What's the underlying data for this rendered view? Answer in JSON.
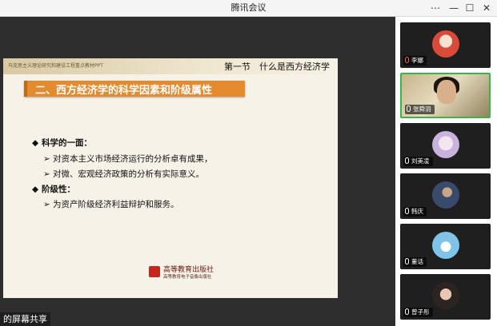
{
  "window": {
    "title": "腾讯会议",
    "min": "—",
    "max": "☐",
    "close": "✕",
    "more": "⋯"
  },
  "slide": {
    "top_small_text": "马克思主义理论研究和建设工程重点教材PPT",
    "section_title": "第一节　什么是西方经济学",
    "heading": "二、西方经济学的科学因素和阶级属性",
    "lines": [
      {
        "mark": "◆",
        "text": "科学的一面：",
        "bold": true
      },
      {
        "mark": "➢",
        "text": "对资本主义市场经济运行的分析卓有成果，",
        "bold": false
      },
      {
        "mark": "➢",
        "text": "对微、宏观经济政策的分析有实际意义。",
        "bold": false
      },
      {
        "mark": "◆",
        "text": "阶级性：",
        "bold": true
      },
      {
        "mark": "➢",
        "text": "为资产阶级经济利益辩护和服务。",
        "bold": false
      }
    ],
    "publisher_cn": "高等教育出版社",
    "publisher_sub": "高等教育电子音像出版社"
  },
  "share_label": "的屏幕共享",
  "participants": [
    {
      "name": "李娜",
      "muted": true,
      "avatar_color": "#d94a3a"
    },
    {
      "name": "张舜羽",
      "muted": false,
      "video": true
    },
    {
      "name": "刘美凌",
      "muted": false,
      "avatar_color": "#d9c6e6"
    },
    {
      "name": "韩庆",
      "muted": false,
      "avatar_color": "#3a4a6a"
    },
    {
      "name": "董话",
      "muted": false,
      "avatar_color": "#7fc3e8"
    },
    {
      "name": "曾子彤",
      "muted": false,
      "avatar_color": "#6b5a52"
    }
  ],
  "colors": {
    "accent_heading": "#e48a2f",
    "muted_mic": "#f25b4b"
  }
}
